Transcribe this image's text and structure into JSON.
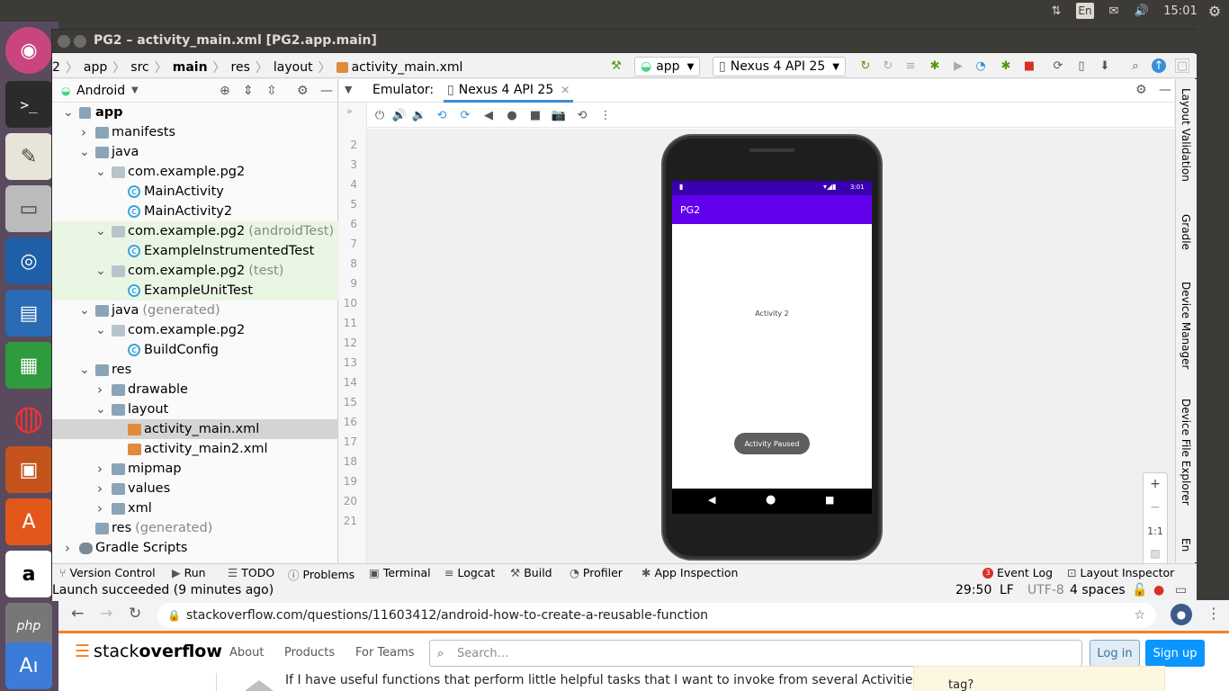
{
  "system": {
    "lang": "En",
    "clock": "15:01"
  },
  "window": {
    "title": "PG2 – activity_main.xml [PG2.app.main]"
  },
  "breadcrumb": [
    "2",
    "app",
    "src",
    "main",
    "res",
    "layout",
    "activity_main.xml"
  ],
  "toolbar": {
    "config": "app",
    "device": "Nexus 4 API 25"
  },
  "project": {
    "view": "Android",
    "tree": [
      {
        "label": "app",
        "suffix": "",
        "depth": 0,
        "icon": "module-icon",
        "open": "open",
        "bold": true,
        "style": ""
      },
      {
        "label": "manifests",
        "suffix": "",
        "depth": 1,
        "icon": "folder-icon",
        "open": "closed",
        "style": ""
      },
      {
        "label": "java",
        "suffix": "",
        "depth": 1,
        "icon": "folder-icon",
        "open": "open",
        "style": ""
      },
      {
        "label": "com.example.pg2",
        "suffix": "",
        "depth": 2,
        "icon": "package-icon",
        "open": "open",
        "style": ""
      },
      {
        "label": "MainActivity",
        "suffix": "",
        "depth": 3,
        "icon": "class-icon",
        "open": "none",
        "style": ""
      },
      {
        "label": "MainActivity2",
        "suffix": "",
        "depth": 3,
        "icon": "class-icon",
        "open": "none",
        "style": ""
      },
      {
        "label": "com.example.pg2",
        "suffix": "(androidTest)",
        "depth": 2,
        "icon": "package-icon",
        "open": "open",
        "style": "tg"
      },
      {
        "label": "ExampleInstrumentedTest",
        "suffix": "",
        "depth": 3,
        "icon": "class-icon",
        "open": "none",
        "style": "tg"
      },
      {
        "label": "com.example.pg2",
        "suffix": "(test)",
        "depth": 2,
        "icon": "package-icon",
        "open": "open",
        "style": "tg"
      },
      {
        "label": "ExampleUnitTest",
        "suffix": "",
        "depth": 3,
        "icon": "class-icon",
        "open": "none",
        "style": "tg"
      },
      {
        "label": "java",
        "suffix": "(generated)",
        "depth": 1,
        "icon": "folder-icon",
        "open": "open",
        "style": ""
      },
      {
        "label": "com.example.pg2",
        "suffix": "",
        "depth": 2,
        "icon": "package-icon",
        "open": "open",
        "style": ""
      },
      {
        "label": "BuildConfig",
        "suffix": "",
        "depth": 3,
        "icon": "class-icon",
        "open": "none",
        "style": ""
      },
      {
        "label": "res",
        "suffix": "",
        "depth": 1,
        "icon": "folder-icon",
        "open": "open",
        "style": ""
      },
      {
        "label": "drawable",
        "suffix": "",
        "depth": 2,
        "icon": "folder-icon",
        "open": "closed",
        "style": ""
      },
      {
        "label": "layout",
        "suffix": "",
        "depth": 2,
        "icon": "folder-icon",
        "open": "open",
        "style": ""
      },
      {
        "label": "activity_main.xml",
        "suffix": "",
        "depth": 3,
        "icon": "xml-icon",
        "open": "none",
        "style": "sel"
      },
      {
        "label": "activity_main2.xml",
        "suffix": "",
        "depth": 3,
        "icon": "xml-icon",
        "open": "none",
        "style": ""
      },
      {
        "label": "mipmap",
        "suffix": "",
        "depth": 2,
        "icon": "folder-icon",
        "open": "closed",
        "style": ""
      },
      {
        "label": "values",
        "suffix": "",
        "depth": 2,
        "icon": "folder-icon",
        "open": "closed",
        "style": ""
      },
      {
        "label": "xml",
        "suffix": "",
        "depth": 2,
        "icon": "folder-icon",
        "open": "closed",
        "style": ""
      },
      {
        "label": "res",
        "suffix": "(generated)",
        "depth": 1,
        "icon": "folder-icon",
        "open": "none",
        "style": ""
      },
      {
        "label": "Gradle Scripts",
        "suffix": "",
        "depth": 0,
        "icon": "gradle-icon",
        "open": "closed",
        "style": ""
      }
    ]
  },
  "emulator": {
    "label": "Emulator:",
    "tab": "Nexus 4 API 25"
  },
  "gutter": [
    "2",
    "3",
    "4",
    "5",
    "6",
    "7",
    "8",
    "9",
    "10",
    "11",
    "12",
    "13",
    "14",
    "15",
    "16",
    "17",
    "18",
    "19",
    "20",
    "21"
  ],
  "phone": {
    "time": "3:01",
    "app_title": "PG2",
    "content": "Activity 2",
    "toast": "Activity Paused"
  },
  "zoom": {
    "plus": "+",
    "minus": "−",
    "ratio": "1:1"
  },
  "right_strip": [
    "Layout Validation",
    "Gradle",
    "Device Manager",
    "Device File Explorer",
    "En"
  ],
  "bottom_tools": [
    "Version Control",
    "Run",
    "TODO",
    "Problems",
    "Terminal",
    "Logcat",
    "Build",
    "Profiler",
    "App Inspection"
  ],
  "bottom_right": {
    "event_log": "Event Log",
    "event_count": "3",
    "layout_inspector": "Layout Inspector"
  },
  "statusbar": {
    "message": "Launch succeeded (9 minutes ago)",
    "position": "29:50",
    "line_sep": "LF",
    "encoding": "UTF-8",
    "indent": "4 spaces"
  },
  "browser": {
    "url": "stackoverflow.com/questions/11603412/android-how-to-create-a-reusable-function"
  },
  "stackoverflow": {
    "logo_a": "stack",
    "logo_b": "overflow",
    "nav": [
      "About",
      "Products",
      "For Teams"
    ],
    "search_placeholder": "Search…",
    "login": "Log in",
    "signup": "Sign up",
    "body_text": "If I have useful functions that perform little helpful tasks that I want to invoke from several Activities,",
    "side_text": "tag?"
  },
  "colors": {
    "accent": "#6200ee",
    "status": "#3a00b0",
    "so_orange": "#f48024",
    "so_blue": "#0a95ff",
    "run_green": "#4e9a06"
  }
}
